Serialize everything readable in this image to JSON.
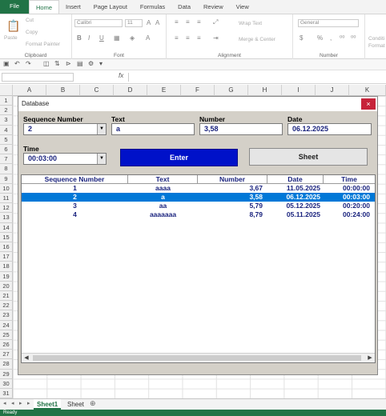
{
  "ribbon_tabs": [
    "File",
    "Home",
    "Insert",
    "Page Layout",
    "Formulas",
    "Data",
    "Review",
    "View"
  ],
  "ribbon": {
    "paste": "Paste",
    "cut": "Cut",
    "copy": "Copy",
    "format_painter": "Format Painter",
    "clipboard": "Clipboard",
    "font_name": "Calibri",
    "font_size": "11",
    "font": "Font",
    "wrap_text": "Wrap Text",
    "merge_center": "Merge & Center",
    "alignment": "Alignment",
    "number_format": "General",
    "number": "Number",
    "conditional": "Conditi Format"
  },
  "formula_bar": {
    "fx": "fx"
  },
  "columns": [
    "A",
    "B",
    "C",
    "D",
    "E",
    "F",
    "G",
    "H",
    "I",
    "J",
    "K"
  ],
  "rows": [
    "1",
    "2",
    "3",
    "4",
    "5",
    "6",
    "7",
    "8",
    "9",
    "10",
    "11",
    "12",
    "13",
    "14",
    "15",
    "16",
    "17",
    "18",
    "19",
    "20",
    "21",
    "22",
    "23",
    "24",
    "25",
    "26",
    "27",
    "28",
    "29",
    "30",
    "31"
  ],
  "sheets": [
    "Sheet1",
    "Sheet"
  ],
  "status": "Ready",
  "dialog": {
    "title": "Database",
    "close": "×",
    "fields": {
      "sequence_label": "Sequence Number",
      "sequence_value": "2",
      "text_label": "Text",
      "text_value": "a",
      "number_label": "Number",
      "number_value": "3,58",
      "date_label": "Date",
      "date_value": "06.12.2025",
      "time_label": "Time",
      "time_value": "00:03:00"
    },
    "enter_button": "Enter",
    "sheet_button": "Sheet",
    "list": {
      "headers": [
        "Sequence Number",
        "Text",
        "Number",
        "Date",
        "Time"
      ],
      "rows": [
        [
          "1",
          "aaaa",
          "3,67",
          "11.05.2025",
          "00:00:00"
        ],
        [
          "2",
          "a",
          "3,58",
          "06.12.2025",
          "00:03:00"
        ],
        [
          "3",
          "aa",
          "5,79",
          "05.12.2025",
          "00:20:00"
        ],
        [
          "4",
          "aaaaaaa",
          "8,79",
          "05.11.2025",
          "00:24:00"
        ]
      ],
      "selected_index": 1
    }
  }
}
